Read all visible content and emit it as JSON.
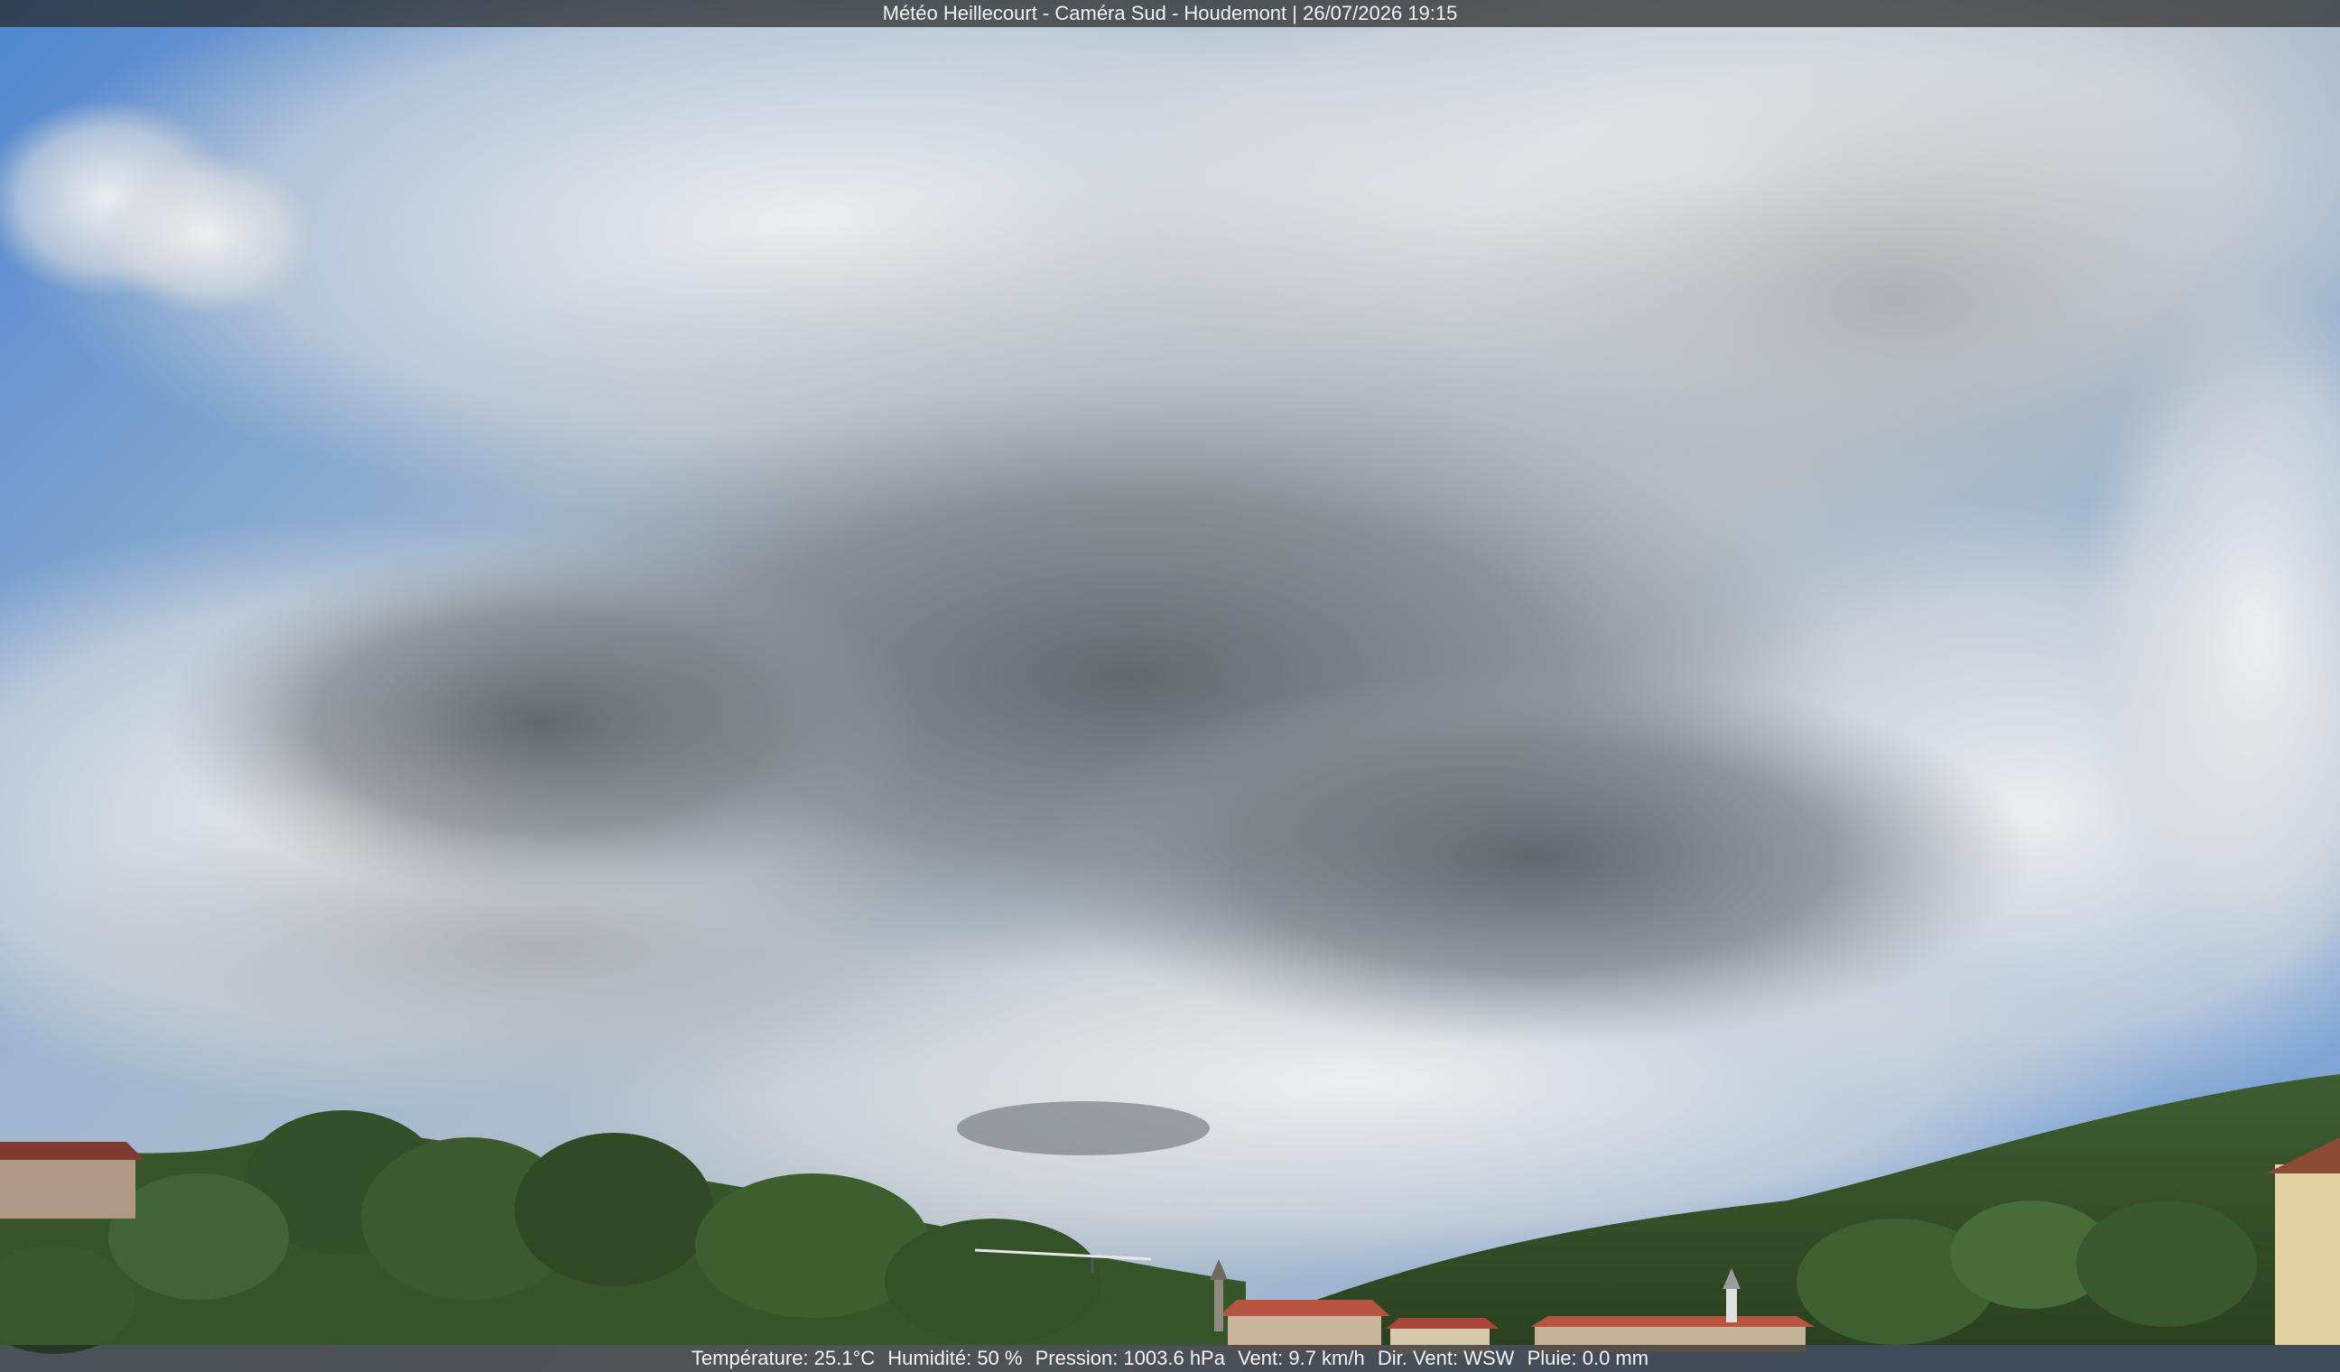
{
  "overlay": {
    "title": "Météo Heillecourt - Caméra Sud - Houdemont | 26/07/2026 19:15"
  },
  "weather": {
    "temperature": "Température: 25.1°C",
    "humidity": "Humidité: 50 %",
    "pressure": "Pression: 1003.6 hPa",
    "wind_speed": "Vent: 9.7 km/h",
    "wind_direction": "Dir. Vent: WSW",
    "rain": "Pluie: 0.0 mm"
  },
  "colors": {
    "sky_blue": "#5f8fcf",
    "cloud_light": "#e6e7e8",
    "cloud_dark": "#6f7478",
    "vegetation": "#3b5a2c",
    "roof": "#b4553f"
  }
}
